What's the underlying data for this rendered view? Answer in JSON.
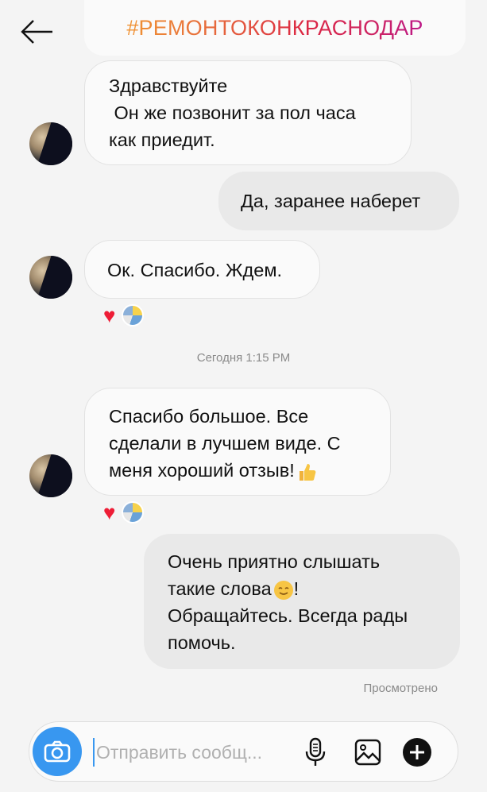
{
  "header": {
    "title": "#РЕМОНТОКОНКРАСНОДАР",
    "back_icon": "arrow-left-icon"
  },
  "messages": [
    {
      "direction": "incoming",
      "lines": [
        "Здравствуйте",
        " Он же позвонит за пол часа",
        "как приедит."
      ]
    },
    {
      "direction": "outgoing",
      "lines": [
        "Да, заранее наберет"
      ]
    },
    {
      "direction": "incoming",
      "lines": [
        "Ок. Спасибо. Ждем."
      ],
      "reactions": [
        "heart-icon",
        "reactor-avatar"
      ]
    },
    {
      "direction": "incoming",
      "lines": [
        "Спасибо большое. Все",
        "сделали в лучшем виде. С",
        "меня хороший отзыв!"
      ],
      "emoji": "thumbs-up-icon",
      "reactions": [
        "heart-icon",
        "reactor-avatar"
      ]
    },
    {
      "direction": "outgoing",
      "lines": [
        "Очень приятно слышать",
        "такие слова",
        "Обращайтесь. Всегда рады",
        "помочь."
      ],
      "emoji_after_line_2": "smiling-face-icon",
      "emoji_trailer": "!"
    }
  ],
  "timestamp": "Сегодня 1:15 PM",
  "status": "Просмотрено",
  "composer": {
    "placeholder": "Отправить сообщ...",
    "camera_icon": "camera-icon",
    "mic_icon": "microphone-icon",
    "gallery_icon": "gallery-icon",
    "plus_icon": "plus-icon"
  },
  "colors": {
    "accent_blue": "#3897f0",
    "heart_red": "#ee1d36",
    "incoming_bg": "#fafafa",
    "outgoing_bg": "#e9e9e9"
  }
}
